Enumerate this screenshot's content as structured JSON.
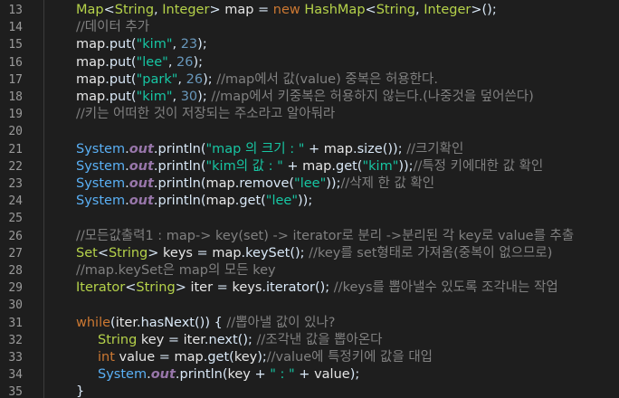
{
  "editor": {
    "lines": [
      {
        "n": "13",
        "indent": 1,
        "tokens": [
          [
            "t-type",
            "Map"
          ],
          [
            "t-plain",
            "<"
          ],
          [
            "t-type",
            "String"
          ],
          [
            "t-plain",
            ", "
          ],
          [
            "t-type",
            "Integer"
          ],
          [
            "t-plain",
            "> "
          ],
          [
            "t-var",
            "map"
          ],
          [
            "t-plain",
            " = "
          ],
          [
            "t-kw",
            "new "
          ],
          [
            "t-type",
            "HashMap"
          ],
          [
            "t-plain",
            "<"
          ],
          [
            "t-type",
            "String"
          ],
          [
            "t-plain",
            ", "
          ],
          [
            "t-type",
            "Integer"
          ],
          [
            "t-plain",
            ">();"
          ]
        ]
      },
      {
        "n": "14",
        "indent": 1,
        "tokens": [
          [
            "t-cm",
            "//데이터 추가"
          ]
        ]
      },
      {
        "n": "15",
        "indent": 1,
        "tokens": [
          [
            "t-var",
            "map"
          ],
          [
            "t-plain",
            "."
          ],
          [
            "t-meth",
            "put"
          ],
          [
            "t-plain",
            "("
          ],
          [
            "t-str",
            "\"kim\""
          ],
          [
            "t-plain",
            ", "
          ],
          [
            "t-num",
            "23"
          ],
          [
            "t-plain",
            ");"
          ]
        ]
      },
      {
        "n": "16",
        "indent": 1,
        "tokens": [
          [
            "t-var",
            "map"
          ],
          [
            "t-plain",
            "."
          ],
          [
            "t-meth",
            "put"
          ],
          [
            "t-plain",
            "("
          ],
          [
            "t-str",
            "\"lee\""
          ],
          [
            "t-plain",
            ", "
          ],
          [
            "t-num",
            "26"
          ],
          [
            "t-plain",
            ");"
          ]
        ]
      },
      {
        "n": "17",
        "indent": 1,
        "tokens": [
          [
            "t-var",
            "map"
          ],
          [
            "t-plain",
            "."
          ],
          [
            "t-meth",
            "put"
          ],
          [
            "t-plain",
            "("
          ],
          [
            "t-str",
            "\"park\""
          ],
          [
            "t-plain",
            ", "
          ],
          [
            "t-num",
            "26"
          ],
          [
            "t-plain",
            "); "
          ],
          [
            "t-cm",
            "//map에서 값(value) 중복은 허용한다."
          ]
        ]
      },
      {
        "n": "18",
        "indent": 1,
        "tokens": [
          [
            "t-var",
            "map"
          ],
          [
            "t-plain",
            "."
          ],
          [
            "t-meth",
            "put"
          ],
          [
            "t-plain",
            "("
          ],
          [
            "t-str",
            "\"kim\""
          ],
          [
            "t-plain",
            ", "
          ],
          [
            "t-num",
            "30"
          ],
          [
            "t-plain",
            "); "
          ],
          [
            "t-cm",
            "//map에서 키중복은 허용하지 않는다.(나중것을 덮어쓴다)"
          ]
        ]
      },
      {
        "n": "19",
        "indent": 1,
        "tokens": [
          [
            "t-cm",
            "//키는 어떠한 것이 저장되는 주소라고 알아둬라"
          ]
        ]
      },
      {
        "n": "20",
        "indent": 0,
        "tokens": []
      },
      {
        "n": "21",
        "indent": 1,
        "tokens": [
          [
            "t-sys",
            "System"
          ],
          [
            "t-plain",
            "."
          ],
          [
            "t-field",
            "out"
          ],
          [
            "t-plain",
            "."
          ],
          [
            "t-meth",
            "println"
          ],
          [
            "t-plain",
            "("
          ],
          [
            "t-str",
            "\"map 의 크기 : \""
          ],
          [
            "t-plain",
            " + "
          ],
          [
            "t-var",
            "map"
          ],
          [
            "t-plain",
            "."
          ],
          [
            "t-meth",
            "size"
          ],
          [
            "t-plain",
            "()); "
          ],
          [
            "t-cm",
            "//크기확인"
          ]
        ]
      },
      {
        "n": "22",
        "indent": 1,
        "tokens": [
          [
            "t-sys",
            "System"
          ],
          [
            "t-plain",
            "."
          ],
          [
            "t-field",
            "out"
          ],
          [
            "t-plain",
            "."
          ],
          [
            "t-meth",
            "println"
          ],
          [
            "t-plain",
            "("
          ],
          [
            "t-str",
            "\"kim의 값 : \""
          ],
          [
            "t-plain",
            " + "
          ],
          [
            "t-var",
            "map"
          ],
          [
            "t-plain",
            "."
          ],
          [
            "t-meth",
            "get"
          ],
          [
            "t-plain",
            "("
          ],
          [
            "t-str",
            "\"kim\""
          ],
          [
            "t-plain",
            "));"
          ],
          [
            "t-cm",
            "//특정 키에대한 값 확인"
          ]
        ]
      },
      {
        "n": "23",
        "indent": 1,
        "tokens": [
          [
            "t-sys",
            "System"
          ],
          [
            "t-plain",
            "."
          ],
          [
            "t-field",
            "out"
          ],
          [
            "t-plain",
            "."
          ],
          [
            "t-meth",
            "println"
          ],
          [
            "t-plain",
            "("
          ],
          [
            "t-var",
            "map"
          ],
          [
            "t-plain",
            "."
          ],
          [
            "t-meth",
            "remove"
          ],
          [
            "t-plain",
            "("
          ],
          [
            "t-str",
            "\"lee\""
          ],
          [
            "t-plain",
            "));"
          ],
          [
            "t-cm",
            "//삭제 한 값 확인"
          ]
        ]
      },
      {
        "n": "24",
        "indent": 1,
        "tokens": [
          [
            "t-sys",
            "System"
          ],
          [
            "t-plain",
            "."
          ],
          [
            "t-field",
            "out"
          ],
          [
            "t-plain",
            "."
          ],
          [
            "t-meth",
            "println"
          ],
          [
            "t-plain",
            "("
          ],
          [
            "t-var",
            "map"
          ],
          [
            "t-plain",
            "."
          ],
          [
            "t-meth",
            "get"
          ],
          [
            "t-plain",
            "("
          ],
          [
            "t-str",
            "\"lee\""
          ],
          [
            "t-plain",
            "));"
          ]
        ]
      },
      {
        "n": "25",
        "indent": 0,
        "tokens": []
      },
      {
        "n": "26",
        "indent": 1,
        "tokens": [
          [
            "t-cm",
            "//모든값출력1 : map-> key(set) -> iterator로 분리 ->분리된 각 key로 value를 추출"
          ]
        ]
      },
      {
        "n": "27",
        "indent": 1,
        "tokens": [
          [
            "t-type",
            "Set"
          ],
          [
            "t-plain",
            "<"
          ],
          [
            "t-type",
            "String"
          ],
          [
            "t-plain",
            "> "
          ],
          [
            "t-var",
            "keys"
          ],
          [
            "t-plain",
            " = "
          ],
          [
            "t-var",
            "map"
          ],
          [
            "t-plain",
            "."
          ],
          [
            "t-meth",
            "keySet"
          ],
          [
            "t-plain",
            "(); "
          ],
          [
            "t-cm",
            "//key를 set형태로 가져옴(중복이 없으므로)"
          ]
        ]
      },
      {
        "n": "28",
        "indent": 1,
        "tokens": [
          [
            "t-cm",
            "//map.keySet은 map의 모든 key"
          ]
        ]
      },
      {
        "n": "29",
        "indent": 1,
        "tokens": [
          [
            "t-type",
            "Iterator"
          ],
          [
            "t-plain",
            "<"
          ],
          [
            "t-type",
            "String"
          ],
          [
            "t-plain",
            "> "
          ],
          [
            "t-var",
            "iter"
          ],
          [
            "t-plain",
            " = "
          ],
          [
            "t-var",
            "keys"
          ],
          [
            "t-plain",
            "."
          ],
          [
            "t-meth",
            "iterator"
          ],
          [
            "t-plain",
            "(); "
          ],
          [
            "t-cm",
            "//keys를 뽑아낼수 있도록 조각내는 작업"
          ]
        ]
      },
      {
        "n": "30",
        "indent": 0,
        "tokens": []
      },
      {
        "n": "31",
        "indent": 1,
        "tokens": [
          [
            "t-kw",
            "while"
          ],
          [
            "t-plain",
            "("
          ],
          [
            "t-var",
            "iter"
          ],
          [
            "t-plain",
            "."
          ],
          [
            "t-meth",
            "hasNext"
          ],
          [
            "t-plain",
            "()) { "
          ],
          [
            "t-cm",
            "//뽑아낼 값이 있나?"
          ]
        ]
      },
      {
        "n": "32",
        "indent": 2,
        "tokens": [
          [
            "t-type",
            "String "
          ],
          [
            "t-var",
            "key"
          ],
          [
            "t-plain",
            " = "
          ],
          [
            "t-var",
            "iter"
          ],
          [
            "t-plain",
            "."
          ],
          [
            "t-meth",
            "next"
          ],
          [
            "t-plain",
            "(); "
          ],
          [
            "t-cm",
            "//조각낸 값을 뽑아온다"
          ]
        ]
      },
      {
        "n": "33",
        "indent": 2,
        "tokens": [
          [
            "t-kw",
            "int "
          ],
          [
            "t-var",
            "value"
          ],
          [
            "t-plain",
            " = "
          ],
          [
            "t-var",
            "map"
          ],
          [
            "t-plain",
            "."
          ],
          [
            "t-meth",
            "get"
          ],
          [
            "t-plain",
            "("
          ],
          [
            "t-var",
            "key"
          ],
          [
            "t-plain",
            ");"
          ],
          [
            "t-cm",
            "//value에 특정키에 값을 대입"
          ]
        ]
      },
      {
        "n": "34",
        "indent": 2,
        "tokens": [
          [
            "t-sys",
            "System"
          ],
          [
            "t-plain",
            "."
          ],
          [
            "t-field",
            "out"
          ],
          [
            "t-plain",
            "."
          ],
          [
            "t-meth",
            "println"
          ],
          [
            "t-plain",
            "("
          ],
          [
            "t-var",
            "key"
          ],
          [
            "t-plain",
            " + "
          ],
          [
            "t-str",
            "\" : \""
          ],
          [
            "t-plain",
            " + "
          ],
          [
            "t-var",
            "value"
          ],
          [
            "t-plain",
            ");"
          ]
        ]
      },
      {
        "n": "35",
        "indent": 1,
        "tokens": [
          [
            "t-plain",
            "}"
          ]
        ]
      }
    ]
  }
}
